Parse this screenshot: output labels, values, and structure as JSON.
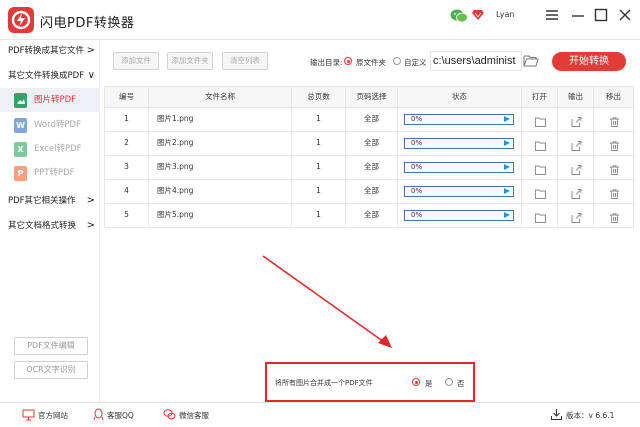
{
  "app": {
    "title": "闪电PDF转换器",
    "username": "Lyan",
    "accent": "#e23a3a"
  },
  "sidebar": {
    "groups": [
      {
        "label": "PDF转换成其它文件",
        "chevron": ">"
      },
      {
        "label": "其它文件转换成PDF",
        "chevron": "∨"
      },
      {
        "label": "PDF其它相关操作",
        "chevron": ">"
      },
      {
        "label": "其它文档格式转换",
        "chevron": ">"
      }
    ],
    "items": [
      {
        "label": "图片转PDF",
        "icon": "image-file-icon",
        "active": true
      },
      {
        "label": "Word转PDF",
        "icon": "word-file-icon",
        "active": false
      },
      {
        "label": "Excel转PDF",
        "icon": "excel-file-icon",
        "active": false
      },
      {
        "label": "PPT转PDF",
        "icon": "ppt-file-icon",
        "active": false
      }
    ],
    "buttons": {
      "edit": "PDF文件编辑",
      "ocr": "OCR文字识别"
    }
  },
  "toolbar": {
    "add_file": "添加文件",
    "add_folder": "添加文件夹",
    "clear_list": "清空列表",
    "output_label": "输出目录:",
    "option_source": "原文件夹",
    "option_custom": "自定义",
    "output_path": "c:\\users\\administ",
    "start": "开始转换"
  },
  "table": {
    "headers": [
      "编号",
      "文件名称",
      "总页数",
      "页码选择",
      "状态",
      "打开",
      "输出",
      "移出"
    ],
    "rows": [
      {
        "no": "1",
        "name": "图片1.png",
        "pages": "1",
        "range": "全部",
        "progress": "0%"
      },
      {
        "no": "2",
        "name": "图片2.png",
        "pages": "1",
        "range": "全部",
        "progress": "0%"
      },
      {
        "no": "3",
        "name": "图片3.png",
        "pages": "1",
        "range": "全部",
        "progress": "0%"
      },
      {
        "no": "4",
        "name": "图片4.png",
        "pages": "1",
        "range": "全部",
        "progress": "0%"
      },
      {
        "no": "5",
        "name": "图片5.png",
        "pages": "1",
        "range": "全部",
        "progress": "0%"
      }
    ]
  },
  "merge": {
    "label": "将所有图片合并成一个PDF文件",
    "yes": "是",
    "no": "否"
  },
  "footer": {
    "website": "官方网站",
    "qq": "客服QQ",
    "wechat": "微信客服",
    "version": "版本：v 6.6.1"
  }
}
